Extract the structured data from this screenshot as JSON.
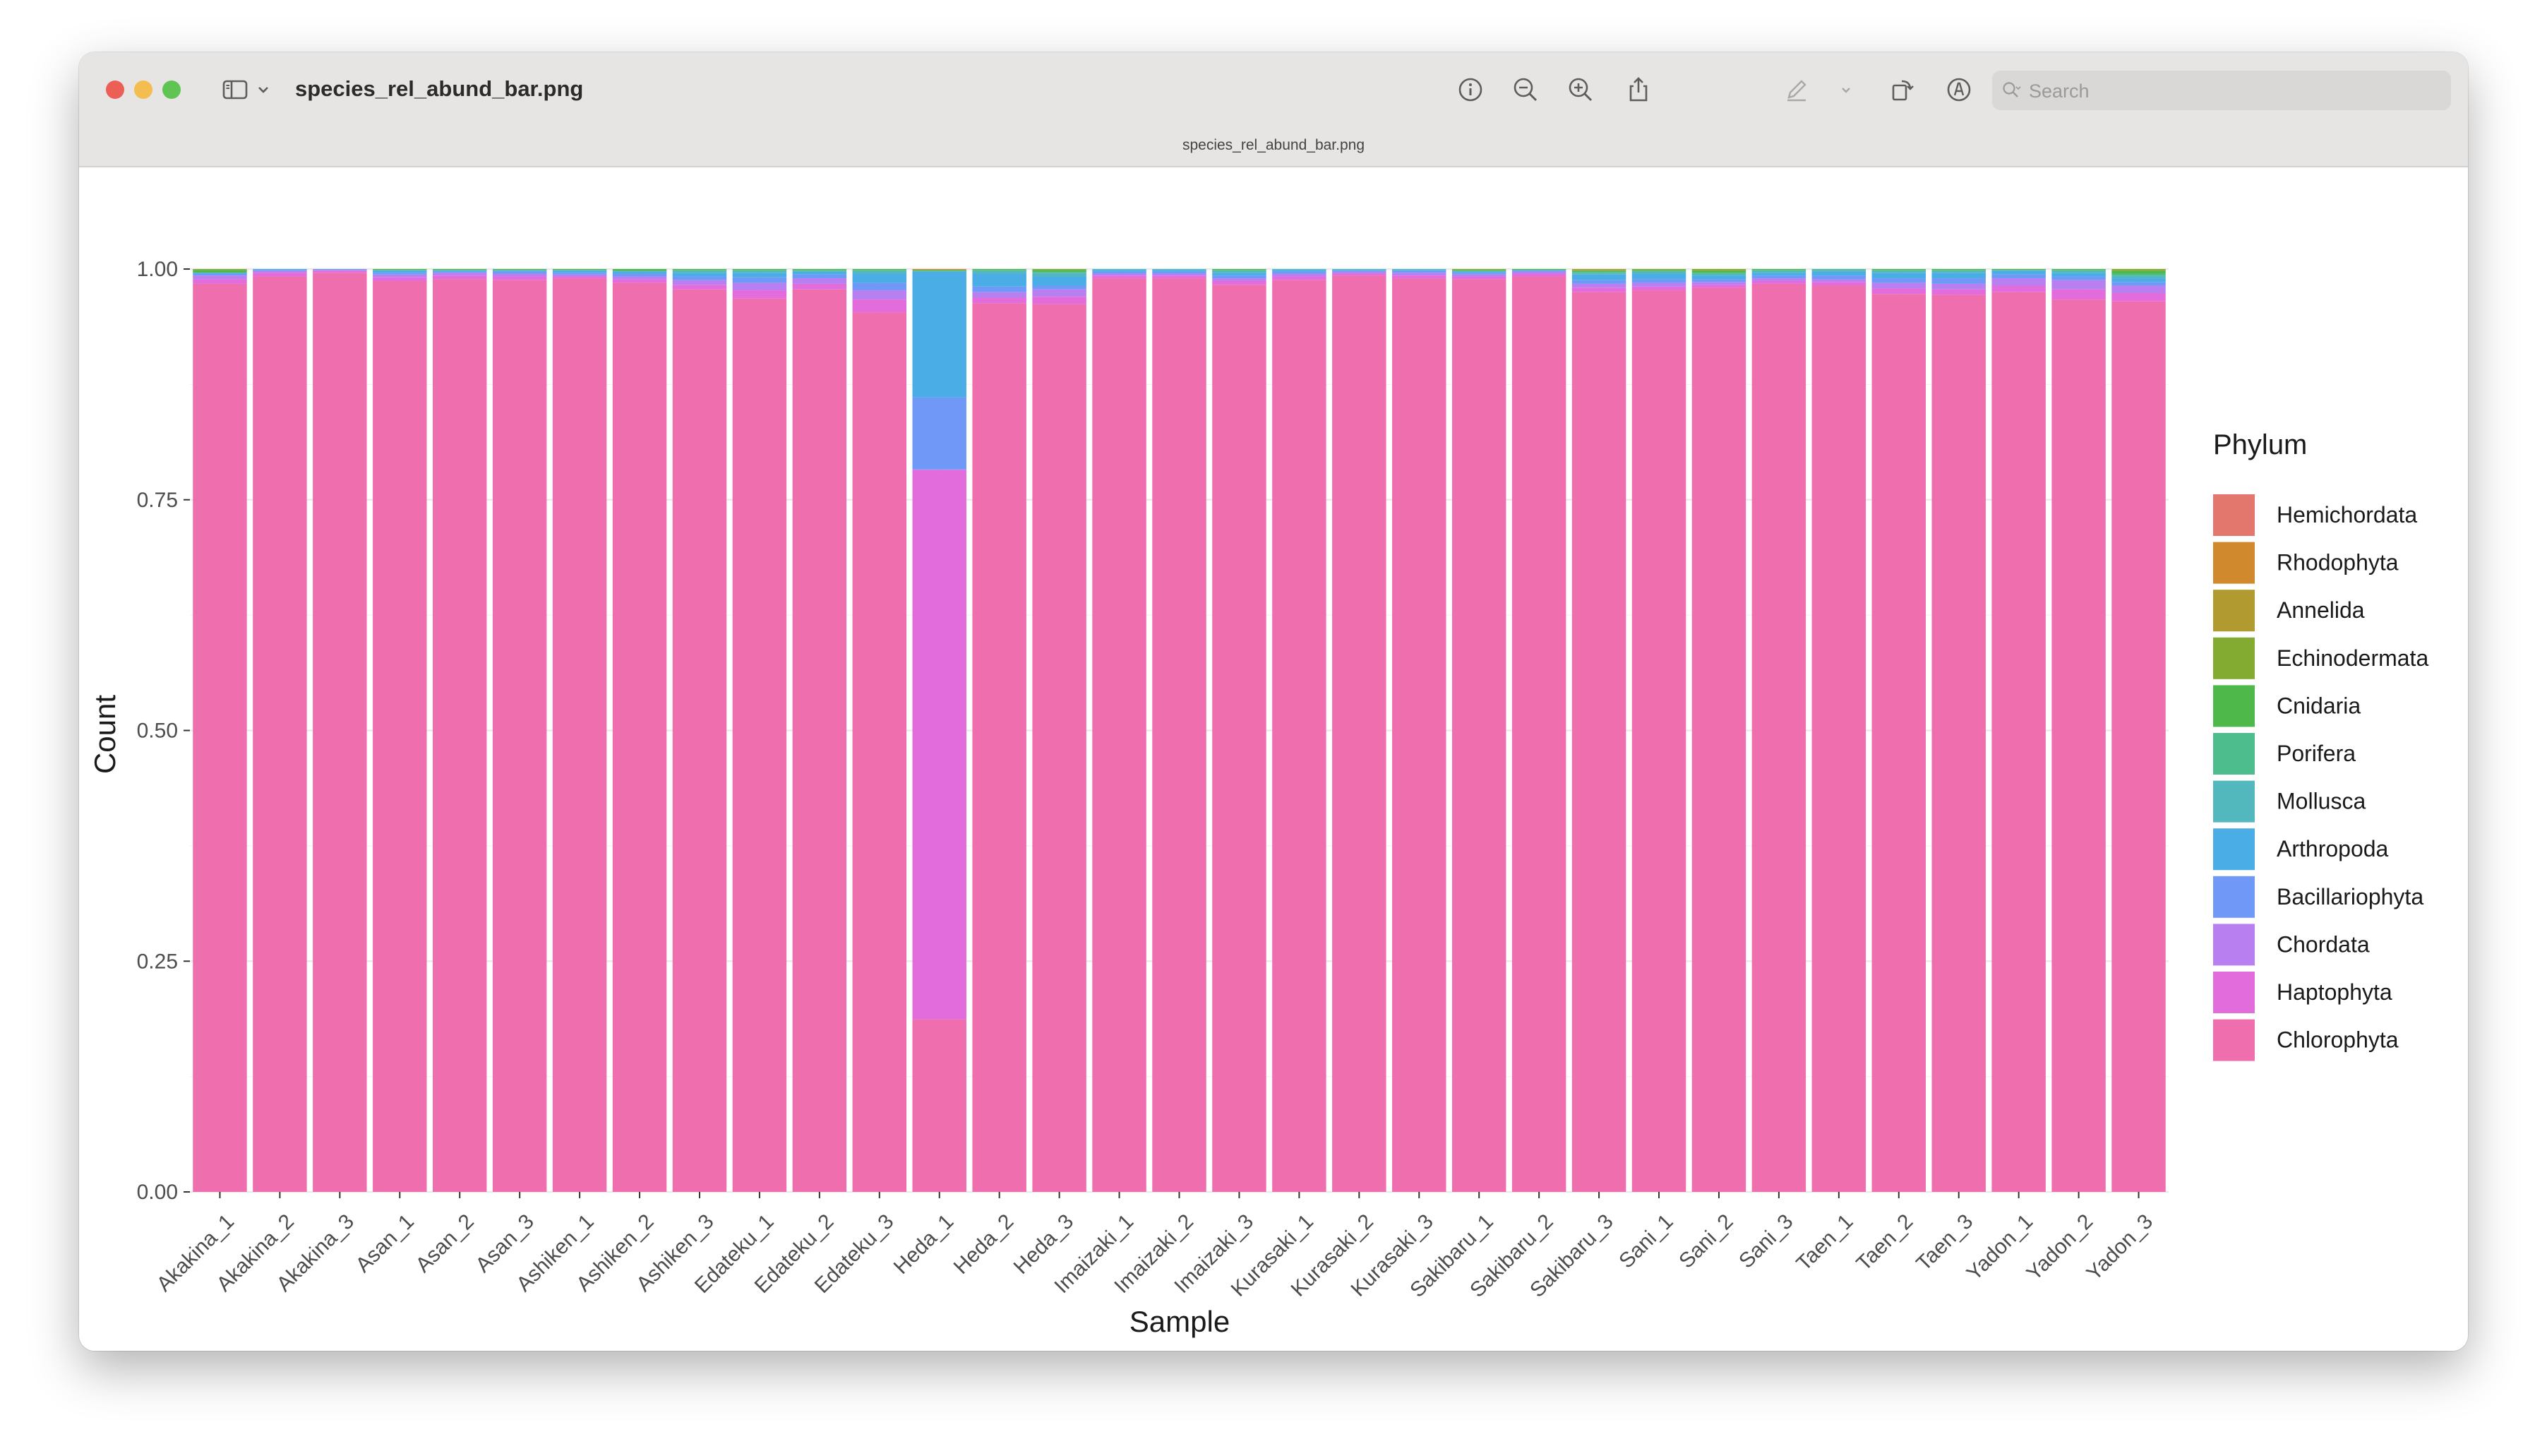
{
  "window": {
    "title": "species_rel_abund_bar.png",
    "subtitle": "species_rel_abund_bar.png",
    "search_placeholder": "Search"
  },
  "toolbar": {
    "icons": [
      "sidebar-toggle-icon",
      "chevron-down-icon",
      "info-icon",
      "zoom-out-icon",
      "zoom-in-icon",
      "share-icon",
      "markup-pen-icon",
      "chevron-down-icon",
      "rotate-icon",
      "markup-circle-icon",
      "signature-icon",
      "search-icon"
    ]
  },
  "colors": {
    "Hemichordata": "#e3776e",
    "Rhodophyta": "#d1892d",
    "Annelida": "#b19b30",
    "Echinodermata": "#84ab31",
    "Cnidaria": "#4fb84a",
    "Porifera": "#4dbd8d",
    "Mollusca": "#52b8bd",
    "Arthropoda": "#4aade6",
    "Bacillariophyta": "#7098f6",
    "Chordata": "#b77ff0",
    "Haptophyta": "#e36cdc",
    "Chlorophyta": "#ef6ead"
  },
  "chart_data": {
    "type": "bar",
    "stacked": true,
    "xlabel": "Sample",
    "ylabel": "Count",
    "ylim": [
      0,
      1
    ],
    "yticks": [
      "0.00",
      "0.25",
      "0.50",
      "0.75",
      "1.00"
    ],
    "grid": true,
    "legend": {
      "title": "Phylum",
      "position": "right"
    },
    "categories": [
      "Akakina_1",
      "Akakina_2",
      "Akakina_3",
      "Asan_1",
      "Asan_2",
      "Asan_3",
      "Ashiken_1",
      "Ashiken_2",
      "Ashiken_3",
      "Edateku_1",
      "Edateku_2",
      "Edateku_3",
      "Heda_1",
      "Heda_2",
      "Heda_3",
      "Imaizaki_1",
      "Imaizaki_2",
      "Imaizaki_3",
      "Kurasaki_1",
      "Kurasaki_2",
      "Kurasaki_3",
      "Sakibaru_1",
      "Sakibaru_2",
      "Sakibaru_3",
      "Sani_1",
      "Sani_2",
      "Sani_3",
      "Taen_1",
      "Taen_2",
      "Taen_3",
      "Yadon_1",
      "Yadon_2",
      "Yadon_3"
    ],
    "series": [
      {
        "name": "Chlorophyta",
        "values": [
          0.984,
          0.992,
          0.996,
          0.987,
          0.989,
          0.988,
          0.99,
          0.985,
          0.978,
          0.968,
          0.978,
          0.953,
          0.187,
          0.963,
          0.962,
          0.99,
          0.99,
          0.983,
          0.988,
          0.993,
          0.99,
          0.989,
          0.992,
          0.975,
          0.977,
          0.98,
          0.984,
          0.982,
          0.973,
          0.972,
          0.975,
          0.967,
          0.965
        ]
      },
      {
        "name": "Haptophyta",
        "values": [
          0.005,
          0.004,
          0.002,
          0.004,
          0.004,
          0.004,
          0.002,
          0.004,
          0.005,
          0.009,
          0.006,
          0.014,
          0.595,
          0.006,
          0.008,
          0.003,
          0.003,
          0.004,
          0.004,
          0.002,
          0.003,
          0.003,
          0.003,
          0.005,
          0.004,
          0.003,
          0.003,
          0.004,
          0.006,
          0.006,
          0.007,
          0.011,
          0.009
        ]
      },
      {
        "name": "Chordata",
        "values": [
          0.004,
          0.002,
          0.001,
          0.003,
          0.003,
          0.003,
          0.002,
          0.003,
          0.005,
          0.008,
          0.006,
          0.01,
          0.001,
          0.006,
          0.008,
          0.002,
          0.002,
          0.003,
          0.003,
          0.002,
          0.003,
          0.002,
          0.002,
          0.004,
          0.004,
          0.003,
          0.003,
          0.003,
          0.006,
          0.006,
          0.008,
          0.01,
          0.008
        ]
      },
      {
        "name": "Bacillariophyta",
        "values": [
          0.002,
          0.001,
          0.001,
          0.002,
          0.001,
          0.002,
          0.002,
          0.003,
          0.004,
          0.006,
          0.004,
          0.008,
          0.078,
          0.006,
          0.004,
          0.002,
          0.002,
          0.003,
          0.002,
          0.001,
          0.002,
          0.002,
          0.001,
          0.004,
          0.004,
          0.003,
          0.003,
          0.004,
          0.005,
          0.006,
          0.004,
          0.004,
          0.004
        ]
      },
      {
        "name": "Arthropoda",
        "values": [
          0.001,
          0.001,
          0.0,
          0.002,
          0.001,
          0.001,
          0.002,
          0.002,
          0.004,
          0.005,
          0.003,
          0.01,
          0.136,
          0.014,
          0.01,
          0.002,
          0.002,
          0.003,
          0.002,
          0.001,
          0.001,
          0.001,
          0.001,
          0.006,
          0.006,
          0.004,
          0.003,
          0.004,
          0.006,
          0.006,
          0.004,
          0.004,
          0.004
        ]
      },
      {
        "name": "Mollusca",
        "values": [
          0.0,
          0.0,
          0.0,
          0.001,
          0.001,
          0.001,
          0.001,
          0.001,
          0.002,
          0.002,
          0.001,
          0.003,
          0.001,
          0.003,
          0.004,
          0.001,
          0.001,
          0.002,
          0.001,
          0.001,
          0.001,
          0.001,
          0.0,
          0.002,
          0.002,
          0.002,
          0.002,
          0.002,
          0.002,
          0.002,
          0.001,
          0.002,
          0.003
        ]
      },
      {
        "name": "Porifera",
        "values": [
          0.0,
          0.0,
          0.0,
          0.0,
          0.0,
          0.0,
          0.0,
          0.0,
          0.001,
          0.001,
          0.001,
          0.001,
          0.0,
          0.001,
          0.001,
          0.0,
          0.0,
          0.001,
          0.0,
          0.0,
          0.0,
          0.0,
          0.0,
          0.001,
          0.001,
          0.001,
          0.001,
          0.001,
          0.001,
          0.001,
          0.0,
          0.001,
          0.002
        ]
      },
      {
        "name": "Cnidaria",
        "values": [
          0.003,
          0.0,
          0.0,
          0.001,
          0.001,
          0.001,
          0.001,
          0.002,
          0.001,
          0.001,
          0.001,
          0.001,
          0.001,
          0.001,
          0.002,
          0.0,
          0.0,
          0.001,
          0.0,
          0.0,
          0.0,
          0.001,
          0.001,
          0.001,
          0.001,
          0.002,
          0.001,
          0.0,
          0.001,
          0.001,
          0.001,
          0.001,
          0.003
        ]
      },
      {
        "name": "Echinodermata",
        "values": [
          0.001,
          0.0,
          0.0,
          0.0,
          0.0,
          0.0,
          0.0,
          0.0,
          0.0,
          0.0,
          0.0,
          0.0,
          0.0,
          0.0,
          0.001,
          0.0,
          0.0,
          0.0,
          0.0,
          0.0,
          0.0,
          0.001,
          0.0,
          0.001,
          0.001,
          0.002,
          0.0,
          0.0,
          0.0,
          0.0,
          0.0,
          0.0,
          0.002
        ]
      },
      {
        "name": "Annelida",
        "values": [
          0.0,
          0.0,
          0.0,
          0.0,
          0.0,
          0.0,
          0.0,
          0.0,
          0.0,
          0.0,
          0.0,
          0.0,
          0.0,
          0.0,
          0.0,
          0.0,
          0.0,
          0.0,
          0.0,
          0.0,
          0.0,
          0.0,
          0.0,
          0.001,
          0.0,
          0.0,
          0.0,
          0.0,
          0.0,
          0.0,
          0.0,
          0.0,
          0.0
        ]
      },
      {
        "name": "Rhodophyta",
        "values": [
          0.0,
          0.0,
          0.0,
          0.0,
          0.0,
          0.0,
          0.0,
          0.0,
          0.0,
          0.0,
          0.0,
          0.0,
          0.001,
          0.0,
          0.0,
          0.0,
          0.0,
          0.0,
          0.0,
          0.0,
          0.0,
          0.0,
          0.0,
          0.0,
          0.0,
          0.0,
          0.0,
          0.0,
          0.0,
          0.0,
          0.0,
          0.0,
          0.0
        ]
      },
      {
        "name": "Hemichordata",
        "values": [
          0.0,
          0.0,
          0.0,
          0.0,
          0.0,
          0.0,
          0.0,
          0.0,
          0.0,
          0.0,
          0.0,
          0.0,
          0.0,
          0.0,
          0.0,
          0.0,
          0.0,
          0.0,
          0.0,
          0.0,
          0.0,
          0.0,
          0.0,
          0.0,
          0.0,
          0.0,
          0.0,
          0.0,
          0.0,
          0.0,
          0.0,
          0.0,
          0.0
        ]
      }
    ],
    "legend_order": [
      "Hemichordata",
      "Rhodophyta",
      "Annelida",
      "Echinodermata",
      "Cnidaria",
      "Porifera",
      "Mollusca",
      "Arthropoda",
      "Bacillariophyta",
      "Chordata",
      "Haptophyta",
      "Chlorophyta"
    ]
  }
}
